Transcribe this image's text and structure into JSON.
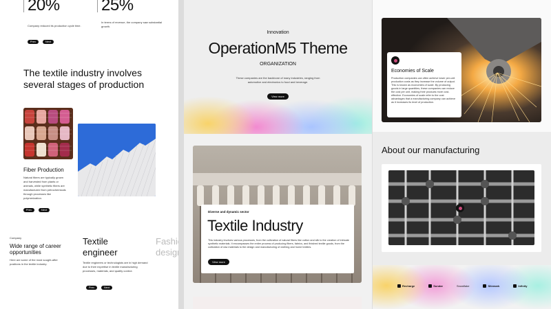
{
  "colA": {
    "stat1_value": "20%",
    "stat1_caption": "Company reduced its production cycle time.",
    "stat2_value": "25%",
    "stat2_caption": "In terms of revenue, the company saw substantial growth.",
    "pill_labels": [
      "Prev",
      "Next"
    ],
    "heading": "The textile industry involves several stages of production",
    "fiber_title": "Fiber Production",
    "fiber_text": "Natural fibers are typically grown and harvested from plants or animals, while synthetic fibers are manufactured from petrochemicals through processes like polymerization.",
    "company_label": "Company",
    "career_title": "Wide range of career opportunities",
    "career_text": "Here are some of the most sought-after positions in the textile industry:",
    "card1_title": "Textile engineer",
    "card1_text": "Textile engineers or technologists are in high demand due to their expertise in textile manufacturing processes, materials, and quality control.",
    "card2_title": "Fashion designer"
  },
  "colB": {
    "eyebrow": "Innovation",
    "title": "OperationM5 Theme",
    "subtitle": "ORGANIZATION",
    "description": "These companies are the backbone of many industries, ranging from automotive and electronics to food and beverage.",
    "button": "View more",
    "card_eyebrow": "Diverse and dynamic sector",
    "card_title": "Textile Industry",
    "card_text": "This industry involves various processes, from the cultivation of natural fibers like cotton and silk to the creation of intricate synthetic materials. It encompasses the entire process of producing fibers, fabrics, and finished textile goods, from the cultivation of raw materials to the design and manufacturing of clothing and home textiles.",
    "card_button": "View more"
  },
  "colC": {
    "econ_title": "Economies of Scale",
    "econ_text": "Production companies can often achieve lower per-unit production costs as they increase the volume of output. This is known as economies of scale. By producing goods in large quantities, these companies can reduce the cost per unit, making their products more cost-effective. Economies of scale refer to the cost advantages that a manufacturing company can achieve as it increases its level of production.",
    "about_heading": "About our manufacturing",
    "logos": [
      "Recharge",
      "Sundar",
      "Snowflake",
      "Sitemark",
      "Infinity"
    ]
  }
}
